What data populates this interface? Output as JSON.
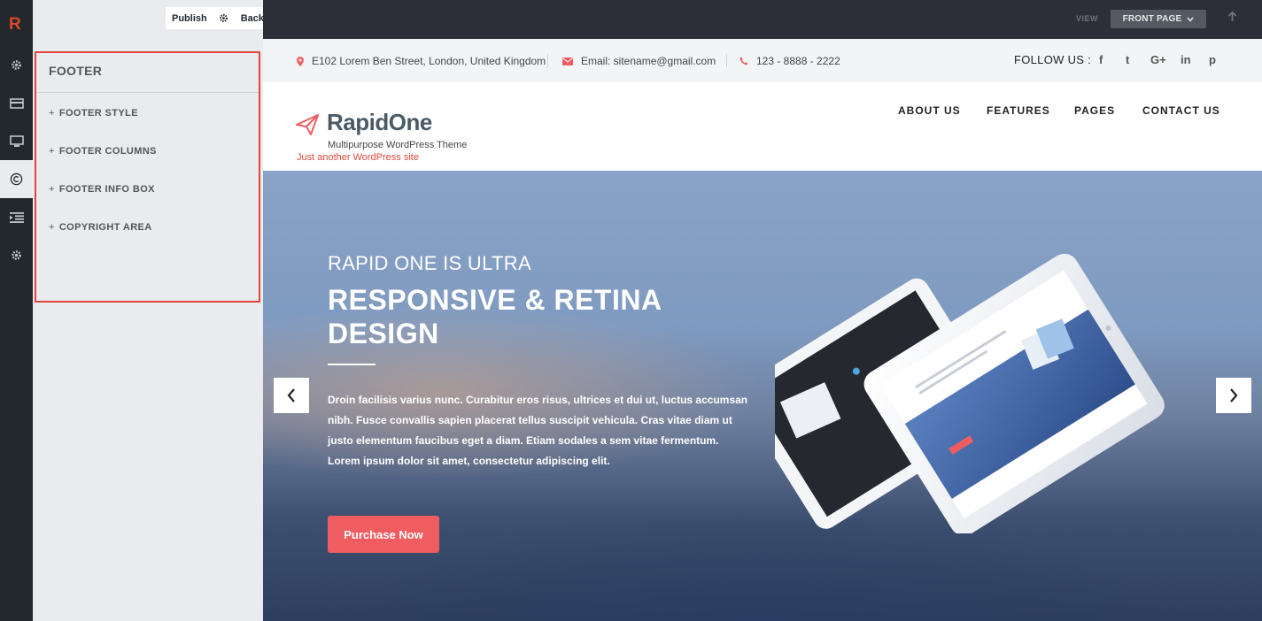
{
  "sidebar": {
    "logo": "R",
    "icons": [
      "gear-icon",
      "card-icon",
      "monitor-icon",
      "copyright-icon",
      "indent-icon",
      "gear-icon"
    ]
  },
  "panel": {
    "publish_label": "Publish",
    "back_label": "Back",
    "section_title": "FOOTER",
    "items": [
      {
        "label": "FOOTER STYLE"
      },
      {
        "label": "FOOTER COLUMNS"
      },
      {
        "label": "FOOTER INFO BOX"
      },
      {
        "label": "COPYRIGHT AREA"
      }
    ]
  },
  "toolbar": {
    "view_label": "VIEW",
    "view_select": "FRONT PAGE"
  },
  "site": {
    "address": "E102 Lorem Ben Street, London, United Kingdom",
    "email": "Email: sitename@gmail.com",
    "phone": "123 - 8888 - 2222",
    "follow": "FOLLOW US :",
    "social": [
      "f",
      "t",
      "G+",
      "in",
      "p"
    ],
    "brand": "RapidOne",
    "tagline": "Multipurpose WordPress Theme",
    "site_tagline": "Just another WordPress site",
    "nav": [
      "ABOUT US",
      "FEATURES",
      "PAGES",
      "CONTACT US"
    ],
    "hero": {
      "subtitle": "RAPID ONE IS ULTRA",
      "title": "RESPONSIVE & RETINA DESIGN",
      "text": "Droin facilisis varius nunc. Curabitur eros risus, ultrices et dui ut, luctus accumsan nibh. Fusce convallis sapien placerat tellus suscipit vehicula. Cras vitae diam ut justo elementum faucibus eget a diam. Etiam sodales a sem vitae fermentum. Lorem ipsum dolor sit amet, consectetur adipiscing elit.",
      "button": "Purchase Now"
    }
  },
  "colors": {
    "accent": "#e2463a",
    "button": "#ef5d61",
    "dark": "#23282d"
  }
}
